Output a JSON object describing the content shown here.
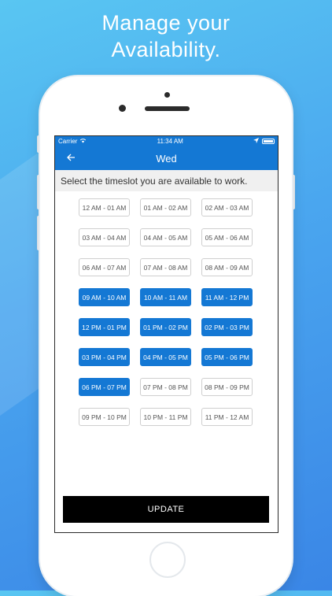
{
  "headline": [
    "Manage your",
    "Availability."
  ],
  "status_bar": {
    "carrier": "Carrier",
    "time": "11:34 AM"
  },
  "nav": {
    "back_icon": "arrow-left-icon",
    "title": "Wed"
  },
  "subheader": "Select the timeslot you are available to work.",
  "colors": {
    "accent": "#1478d4",
    "button": "#000000"
  },
  "slots": [
    {
      "label": "12 AM - 01 AM",
      "selected": false
    },
    {
      "label": "01 AM - 02 AM",
      "selected": false
    },
    {
      "label": "02 AM - 03 AM",
      "selected": false
    },
    {
      "label": "03 AM - 04 AM",
      "selected": false
    },
    {
      "label": "04 AM - 05 AM",
      "selected": false
    },
    {
      "label": "05 AM - 06 AM",
      "selected": false
    },
    {
      "label": "06 AM - 07 AM",
      "selected": false
    },
    {
      "label": "07 AM - 08 AM",
      "selected": false
    },
    {
      "label": "08 AM - 09 AM",
      "selected": false
    },
    {
      "label": "09 AM - 10 AM",
      "selected": true
    },
    {
      "label": "10 AM - 11 AM",
      "selected": true
    },
    {
      "label": "11 AM - 12 PM",
      "selected": true
    },
    {
      "label": "12 PM - 01 PM",
      "selected": true
    },
    {
      "label": "01 PM - 02 PM",
      "selected": true
    },
    {
      "label": "02 PM - 03 PM",
      "selected": true
    },
    {
      "label": "03 PM - 04 PM",
      "selected": true
    },
    {
      "label": "04 PM - 05 PM",
      "selected": true
    },
    {
      "label": "05 PM - 06 PM",
      "selected": true
    },
    {
      "label": "06 PM - 07 PM",
      "selected": true
    },
    {
      "label": "07 PM - 08 PM",
      "selected": false
    },
    {
      "label": "08 PM - 09 PM",
      "selected": false
    },
    {
      "label": "09 PM - 10 PM",
      "selected": false
    },
    {
      "label": "10 PM - 11 PM",
      "selected": false
    },
    {
      "label": "11 PM - 12 AM",
      "selected": false
    }
  ],
  "update_label": "UPDATE"
}
